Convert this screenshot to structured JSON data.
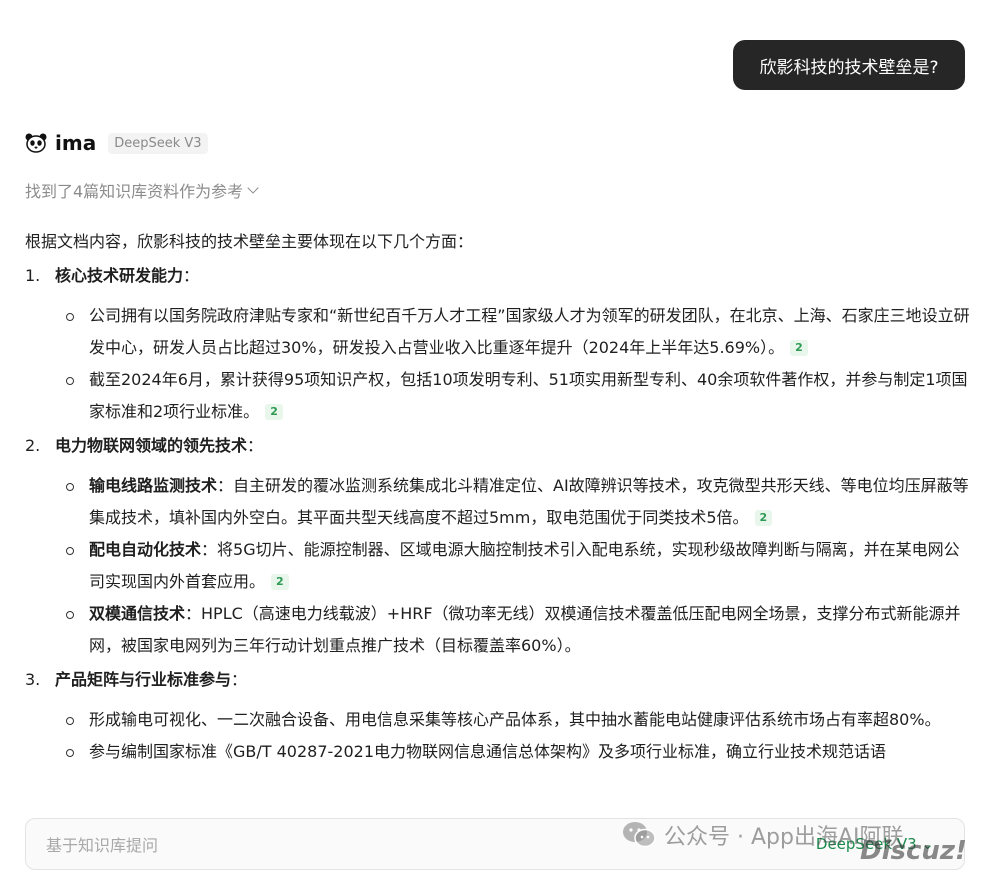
{
  "user_message": "欣影科技的技术壁垒是?",
  "assistant": {
    "name": "ima",
    "model_tag": "DeepSeek V3",
    "sources_text": "找到了4篇知识库资料作为参考"
  },
  "answer": {
    "intro": "根据文档内容，欣影科技的技术壁垒主要体现在以下几个方面：",
    "sections": [
      {
        "num": "1.",
        "title": "核心技术研发能力",
        "colon": "：",
        "items": [
          {
            "text": "公司拥有以国务院政府津贴专家和“新世纪百千万人才工程”国家级人才为领军的研发团队，在北京、上海、石家庄三地设立研发中心，研发人员占比超过30%，研发投入占营业收入比重逐年提升（2024年上半年达5.69%）。",
            "cite": "2"
          },
          {
            "text": "截至2024年6月，累计获得95项知识产权，包括10项发明专利、51项实用新型专利、40余项软件著作权，并参与制定1项国家标准和2项行业标准。",
            "cite": "2"
          }
        ]
      },
      {
        "num": "2.",
        "title": "电力物联网领域的领先技术",
        "colon": "：",
        "items": [
          {
            "bold": "输电线路监测技术",
            "text": "：自主研发的覆冰监测系统集成北斗精准定位、AI故障辨识等技术，攻克微型共形天线、等电位均压屏蔽等集成技术，填补国内外空白。其平面共型天线高度不超过5mm，取电范围优于同类技术5倍。",
            "cite": "2"
          },
          {
            "bold": "配电自动化技术",
            "text": "：将5G切片、能源控制器、区域电源大脑控制技术引入配电系统，实现秒级故障判断与隔离，并在某电网公司实现国内外首套应用。",
            "cite": "2"
          },
          {
            "bold": "双模通信技术",
            "text": "：HPLC（高速电力线载波）+HRF（微功率无线）双模通信技术覆盖低压配电网全场景，支撑分布式新能源并网，被国家电网列为三年行动计划重点推广技术（目标覆盖率60%）。"
          }
        ]
      },
      {
        "num": "3.",
        "title": "产品矩阵与行业标准参与",
        "colon": "：",
        "items": [
          {
            "text": "形成输电可视化、一二次融合设备、用电信息采集等核心产品体系，其中抽水蓄能电站健康评估系统市场占有率超80%。"
          },
          {
            "text": "参与编制国家标准《GB/T 40287-2021电力物联网信息通信总体架构》及多项行业标准，确立行业技术规范话语"
          }
        ]
      }
    ]
  },
  "input": {
    "placeholder": "基于知识库提问",
    "model": "DeepSeek V3 ⌄"
  },
  "watermark": {
    "text": "公众号 · App出海AI阿联",
    "discuz": "Discuz!"
  },
  "colors": {
    "user_bubble": "#262626",
    "citation_bg": "#e8f6ec",
    "citation_text": "#2e9a55",
    "model_select": "#1a8b4c"
  }
}
